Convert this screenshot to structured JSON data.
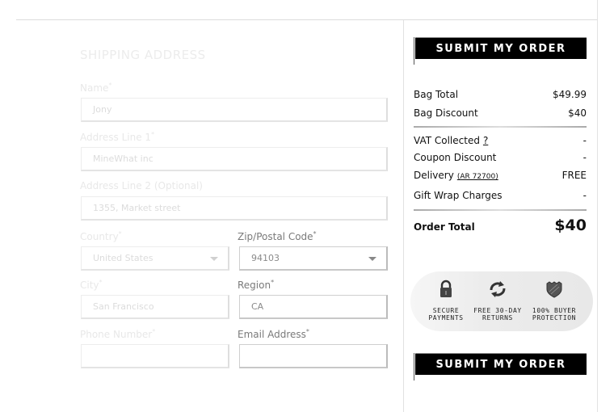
{
  "shipping": {
    "title": "SHIPPING ADDRESS",
    "fields": {
      "name": {
        "label": "Name",
        "required": "*",
        "value": "Jony"
      },
      "address1": {
        "label": "Address Line 1",
        "required": "*",
        "value": "MineWhat inc"
      },
      "address2": {
        "label": "Address Line 2 (Optional)",
        "value": "1355, Market street"
      },
      "country": {
        "label": "Country",
        "required": "*",
        "value": "United States"
      },
      "zip": {
        "label": "Zip/Postal Code",
        "required": "*",
        "value": "94103"
      },
      "city": {
        "label": "City",
        "required": "*",
        "value": "San Francisco"
      },
      "region": {
        "label": "Region",
        "required": "*",
        "value": "CA"
      },
      "phone": {
        "label": "Phone Number",
        "required": "*",
        "value": ""
      },
      "email": {
        "label": "Email Address",
        "required": "*",
        "value": ""
      }
    }
  },
  "summary": {
    "submit_label": "SUBMIT MY ORDER",
    "bag_total": {
      "label": "Bag Total",
      "value": "$49.99"
    },
    "bag_discount": {
      "label": "Bag Discount",
      "value": "$40"
    },
    "vat": {
      "label": "VAT Collected",
      "help": "?",
      "value": "-"
    },
    "coupon": {
      "label": "Coupon Discount",
      "value": "-"
    },
    "delivery": {
      "label": "Delivery",
      "zip_link": "(AR 72700)",
      "value": "FREE"
    },
    "gift_wrap": {
      "label": "Gift Wrap Charges",
      "value": "-"
    },
    "order_total": {
      "label": "Order Total",
      "value": "$40"
    }
  },
  "trust_badges": [
    {
      "icon": "lock-icon",
      "line1": "SECURE",
      "line2": "PAYMENTS"
    },
    {
      "icon": "refresh-icon",
      "line1": "FREE 30-DAY",
      "line2": "RETURNS"
    },
    {
      "icon": "shield-icon",
      "line1": "100% BUYER",
      "line2": "PROTECTION"
    }
  ]
}
